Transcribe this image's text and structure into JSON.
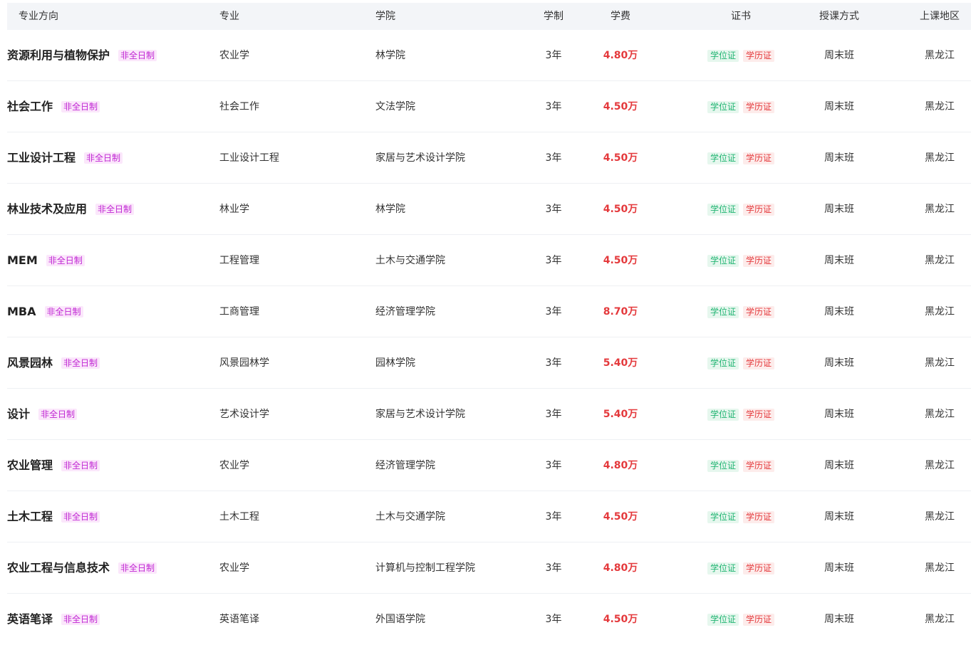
{
  "header": {
    "direction": "专业方向",
    "major": "专业",
    "college": "学院",
    "years": "学制",
    "fee": "学费",
    "cert": "证书",
    "method": "授课方式",
    "region": "上课地区"
  },
  "colors": {
    "fee_red": "#e4393c",
    "mode_tag": "#c026d3",
    "degree_green": "#22b573",
    "diploma_red": "#e4393c",
    "header_bg": "#f3f5f8"
  },
  "rows": [
    {
      "direction": "资源利用与植物保护",
      "mode": "非全日制",
      "major": "农业学",
      "college": "林学院",
      "years": "3年",
      "fee": "4.80万",
      "degree": "学位证",
      "diploma": "学历证",
      "method": "周末班",
      "region": "黑龙江"
    },
    {
      "direction": "社会工作",
      "mode": "非全日制",
      "major": "社会工作",
      "college": "文法学院",
      "years": "3年",
      "fee": "4.50万",
      "degree": "学位证",
      "diploma": "学历证",
      "method": "周末班",
      "region": "黑龙江"
    },
    {
      "direction": "工业设计工程",
      "mode": "非全日制",
      "major": "工业设计工程",
      "college": "家居与艺术设计学院",
      "years": "3年",
      "fee": "4.50万",
      "degree": "学位证",
      "diploma": "学历证",
      "method": "周末班",
      "region": "黑龙江"
    },
    {
      "direction": "林业技术及应用",
      "mode": "非全日制",
      "major": "林业学",
      "college": "林学院",
      "years": "3年",
      "fee": "4.50万",
      "degree": "学位证",
      "diploma": "学历证",
      "method": "周末班",
      "region": "黑龙江"
    },
    {
      "direction": "MEM",
      "mode": "非全日制",
      "major": "工程管理",
      "college": "土木与交通学院",
      "years": "3年",
      "fee": "4.50万",
      "degree": "学位证",
      "diploma": "学历证",
      "method": "周末班",
      "region": "黑龙江"
    },
    {
      "direction": "MBA",
      "mode": "非全日制",
      "major": "工商管理",
      "college": "经济管理学院",
      "years": "3年",
      "fee": "8.70万",
      "degree": "学位证",
      "diploma": "学历证",
      "method": "周末班",
      "region": "黑龙江"
    },
    {
      "direction": "风景园林",
      "mode": "非全日制",
      "major": "风景园林学",
      "college": "园林学院",
      "years": "3年",
      "fee": "5.40万",
      "degree": "学位证",
      "diploma": "学历证",
      "method": "周末班",
      "region": "黑龙江"
    },
    {
      "direction": "设计",
      "mode": "非全日制",
      "major": "艺术设计学",
      "college": "家居与艺术设计学院",
      "years": "3年",
      "fee": "5.40万",
      "degree": "学位证",
      "diploma": "学历证",
      "method": "周末班",
      "region": "黑龙江"
    },
    {
      "direction": "农业管理",
      "mode": "非全日制",
      "major": "农业学",
      "college": "经济管理学院",
      "years": "3年",
      "fee": "4.80万",
      "degree": "学位证",
      "diploma": "学历证",
      "method": "周末班",
      "region": "黑龙江"
    },
    {
      "direction": "土木工程",
      "mode": "非全日制",
      "major": "土木工程",
      "college": "土木与交通学院",
      "years": "3年",
      "fee": "4.50万",
      "degree": "学位证",
      "diploma": "学历证",
      "method": "周末班",
      "region": "黑龙江"
    },
    {
      "direction": "农业工程与信息技术",
      "mode": "非全日制",
      "major": "农业学",
      "college": "计算机与控制工程学院",
      "years": "3年",
      "fee": "4.80万",
      "degree": "学位证",
      "diploma": "学历证",
      "method": "周末班",
      "region": "黑龙江"
    },
    {
      "direction": "英语笔译",
      "mode": "非全日制",
      "major": "英语笔译",
      "college": "外国语学院",
      "years": "3年",
      "fee": "4.50万",
      "degree": "学位证",
      "diploma": "学历证",
      "method": "周末班",
      "region": "黑龙江"
    }
  ]
}
